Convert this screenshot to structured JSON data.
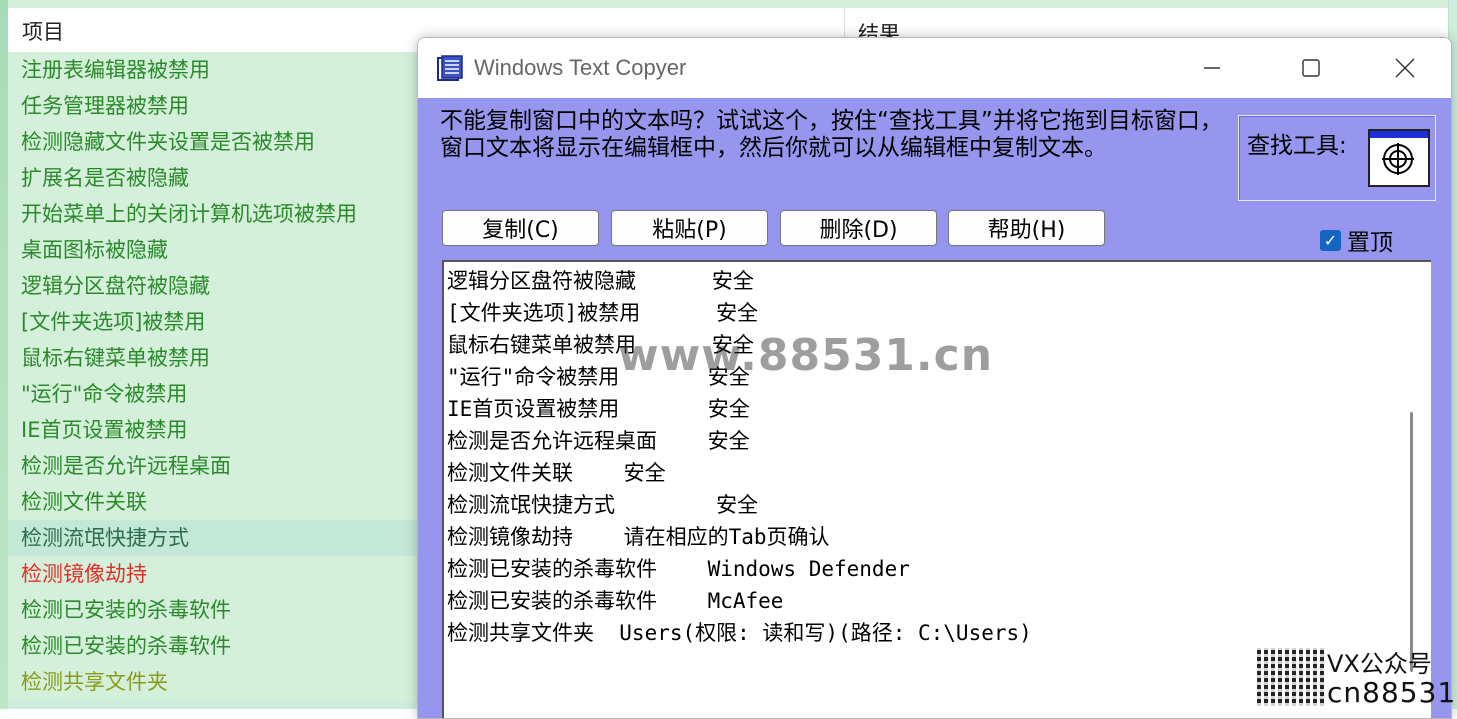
{
  "background_list": {
    "header": {
      "col_item": "项目",
      "col_result": "结果"
    },
    "rows": [
      "注册表编辑器被禁用",
      "任务管理器被禁用",
      "检测隐藏文件夹设置是否被禁用",
      "扩展名是否被隐藏",
      "开始菜单上的关闭计算机选项被禁用",
      "桌面图标被隐藏",
      "逻辑分区盘符被隐藏",
      "[文件夹选项]被禁用",
      "鼠标右键菜单被禁用",
      "\"运行\"命令被禁用",
      "IE首页设置被禁用",
      "检测是否允许远程桌面",
      "检测文件关联",
      "检测流氓快捷方式",
      "检测镜像劫持",
      "检测已安装的杀毒软件",
      "检测已安装的杀毒软件",
      "检测共享文件夹"
    ],
    "selected_index": 13,
    "red_index": 14,
    "olive_index": 17
  },
  "dialog": {
    "title": "Windows Text Copyer",
    "instructions": "不能复制窗口中的文本吗？试试这个，按住“查找工具”并将它拖到目标窗口，窗口文本将显示在编辑框中，然后你就可以从编辑框中复制文本。",
    "finder_label": "查找工具:",
    "buttons": {
      "copy": "复制(C)",
      "paste": "粘贴(P)",
      "delete": "删除(D)",
      "help": "帮助(H)"
    },
    "topmost_label": "置顶",
    "topmost_checked": true,
    "edit_lines": [
      "逻辑分区盘符被隐藏      安全",
      "[文件夹选项]被禁用      安全",
      "鼠标右键菜单被禁用      安全",
      "\"运行\"命令被禁用       安全",
      "IE首页设置被禁用       安全",
      "检测是否允许远程桌面    安全",
      "检测文件关联    安全",
      "检测流氓快捷方式        安全",
      "检测镜像劫持    请在相应的Tab页确认",
      "检测已安装的杀毒软件    Windows Defender",
      "检测已安装的杀毒软件    McAfee",
      "检测共享文件夹  Users(权限: 读和写)(路径: C:\\Users)"
    ]
  },
  "overlay": {
    "watermark": "www.88531.cn",
    "vx_label": "VX公众号",
    "vx_sub": "cn88531"
  },
  "colors": {
    "dialog_client": "#9696ee",
    "list_text": "#2a8a2a",
    "list_bg": "#d4f0db",
    "checkbox": "#1565c0"
  }
}
